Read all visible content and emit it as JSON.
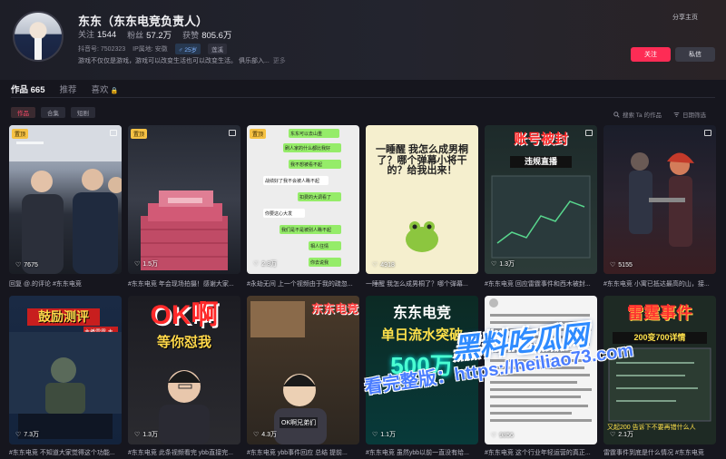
{
  "profile": {
    "name": "东东（东东电竞负责人）",
    "following_label": "关注",
    "following": "1544",
    "followers_label": "粉丝",
    "followers": "57.2万",
    "likes_label": "获赞",
    "likes": "805.6万",
    "id_label": "抖音号: 7502323",
    "ip_label": "IP属地: 安徽",
    "tag_age": "♂ 25岁",
    "tag_city": "莲溪",
    "bio": "游戏不仅仅是游戏，游戏可以改变生活也可以改变生活。 俱乐部入...",
    "bio_more": "更多"
  },
  "header": {
    "share": "分享主页",
    "follow_button": "关注",
    "message_button": "私信"
  },
  "tabs": [
    {
      "label": "作品 665"
    },
    {
      "label": "推荐"
    },
    {
      "label": "喜欢"
    }
  ],
  "filters": [
    {
      "label": "作品"
    },
    {
      "label": "合集"
    },
    {
      "label": "短剧"
    }
  ],
  "toolbar": {
    "search_label": "搜索 Ta 的作品",
    "sort_label": "日期筛选"
  },
  "videos": [
    {
      "pinned": "置顶",
      "likes": "7675",
      "caption": "回复 @.的评论 #东东电竞"
    },
    {
      "pinned": "置顶",
      "likes": "1.5万",
      "caption": "#东东电竞 年会现场拍摄！感谢大家..."
    },
    {
      "pinned": "置顶",
      "likes": "2.8万",
      "caption": "#永劫无间 上一个视频由于我的疏忽..."
    },
    {
      "pinned": "",
      "likes": "4918",
      "caption": "一睡醒 我怎么成男桐了？哪个弹幕..."
    },
    {
      "pinned": "",
      "likes": "1.3万",
      "caption": "#东东电竞 回应雷霆事件和西木被封..."
    },
    {
      "pinned": "",
      "likes": "5155",
      "caption": "#东东电竞 小寓已抵达最高的山，接..."
    },
    {
      "pinned": "",
      "likes": "7.3万",
      "caption": "#东东电竞 不知道大家觉得这个功能..."
    },
    {
      "pinned": "",
      "likes": "1.3万",
      "caption": "#东东电竞 此条视频看完 ybb直接完..."
    },
    {
      "pinned": "",
      "likes": "4.3万",
      "caption": "#东东电竞 ybb事件回应 总结 提前..."
    },
    {
      "pinned": "",
      "likes": "1.1万",
      "caption": "#东东电竞 虽然ybb以前一直没有给..."
    },
    {
      "pinned": "",
      "likes": "9856",
      "caption": "#东东电竞 这个行业年轻运营的真正..."
    },
    {
      "pinned": "",
      "likes": "2.1万",
      "caption": "雷霆事件到底是什么情况 #东东电竞"
    }
  ],
  "thumbs": {
    "t4": "一睡醒 我怎么成男桐了？哪个弹幕小将干的？给我出来！",
    "t5_a": "账号被封",
    "t5_b": "违规直播",
    "t7": "鼓励测评",
    "t7_b": "主播雷霆 主播雷霆",
    "t8_a": "OK啊",
    "t8_b": "等你怼我",
    "t9_a": "东东电竞",
    "t9_b": "OK啊兄弟们",
    "t10_a": "东东电竞",
    "t10_b": "单日流水突破",
    "t10_c": "500万",
    "t11": "又起200 告诉下不要再错什么人",
    "t12_a": "雷霆事件",
    "t12_b": "200变700详情"
  },
  "chat_lines": [
    "东东可以去山重",
    "刷人家的什么都比我好",
    "我不想被看不起",
    "战绩好了我不会被人瞧不起",
    "扣费的大调看了",
    "你要这心大发",
    "我们是不是被别人瞧不起",
    "相人往情",
    "你去说我"
  ],
  "watermark": {
    "site": "黑料吃瓜网",
    "url": "看完整版：https://heiliao73.com"
  },
  "colors": {
    "accent": "#fe2c55",
    "background": "#16161e",
    "pin": "#f6c244",
    "watermark": "#2e8bff"
  }
}
